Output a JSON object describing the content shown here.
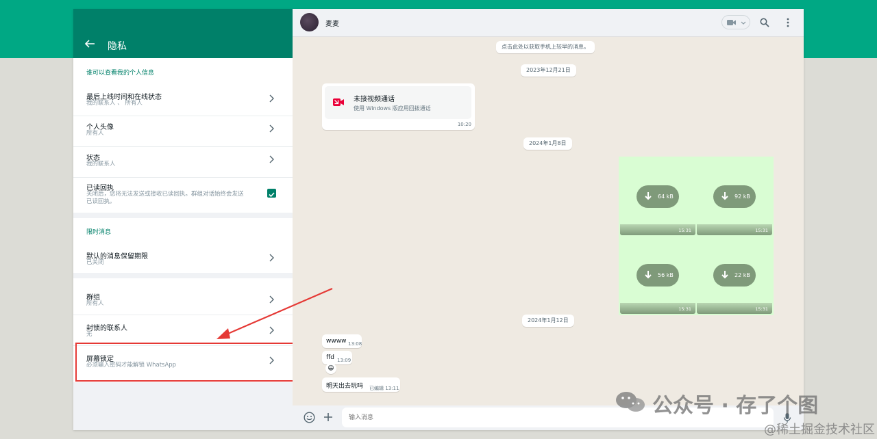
{
  "left": {
    "title": "隐私",
    "section1_title": "谁可以查看我的个人信息",
    "rows1": [
      {
        "title": "最后上线时间和在线状态",
        "sub": "我的联系人 、 所有人"
      },
      {
        "title": "个人头像",
        "sub": "所有人"
      },
      {
        "title": "状态",
        "sub": "我的联系人"
      },
      {
        "title": "已读回执",
        "sub": "关闭后，您将无法发送或接收已读回执。群组对话始终会发送已读回执。"
      }
    ],
    "read_receipt_sub_line1": "关闭后，您将无法发送或接收已读回执。群组对话始终会发送",
    "read_receipt_sub_line2": "已读回执。",
    "section2_title": "限时消息",
    "row_disappearing": {
      "title": "默认的消息保留期限",
      "sub": "已关闭"
    },
    "row_groups": {
      "title": "群组",
      "sub": "所有人"
    },
    "row_blocked": {
      "title": "封锁的联系人",
      "sub": "无"
    },
    "row_screenlock": {
      "title": "屏幕锁定",
      "sub": "必须输入密码才能解锁 WhatsApp"
    }
  },
  "chat": {
    "contact_name": "麦麦",
    "sync_notice": "点击此处以获取手机上较早的消息。",
    "date1": "2023年12月21日",
    "missed_call_title": "未接视频通话",
    "missed_call_sub": "使用 Windows 版应用回拨通话",
    "missed_call_time": "10:20",
    "date2": "2024年1月8日",
    "images": [
      {
        "size": "64 kB",
        "time": "15:31"
      },
      {
        "size": "92 kB",
        "time": "15:31"
      },
      {
        "size": "56 kB",
        "time": "15:31"
      },
      {
        "size": "22 kB",
        "time": "15:31"
      }
    ],
    "date3": "2024年1月12日",
    "messages": [
      {
        "text": "wwww",
        "time": "13:08"
      },
      {
        "text": "ffd",
        "time": "13:09"
      },
      {
        "text": "明天出去玩吗",
        "time": "已编辑 13:11"
      }
    ],
    "reaction": "😀",
    "input_placeholder": "输入消息"
  },
  "watermark": {
    "line1": "公众号 · 存了个图",
    "line2": "@稀土掘金技术社区"
  },
  "colors": {
    "brand": "#00a884",
    "header": "#008069",
    "highlight": "#e53935"
  }
}
